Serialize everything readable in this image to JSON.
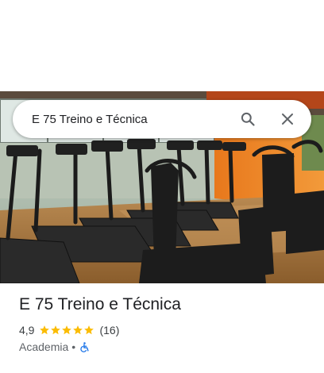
{
  "search": {
    "query": "E 75 Treino e Técnica"
  },
  "place": {
    "name": "E 75 Treino e Técnica",
    "rating": "4,9",
    "stars_filled": 5,
    "review_count": "(16)",
    "category": "Academia",
    "separator": "•"
  },
  "icons": {
    "search": "search-icon",
    "close": "close-icon",
    "star": "star-icon",
    "accessibility": "wheelchair-accessible-icon"
  },
  "colors": {
    "star": "#fbbc04",
    "accessibility": "#1a73e8",
    "title": "#202124"
  }
}
